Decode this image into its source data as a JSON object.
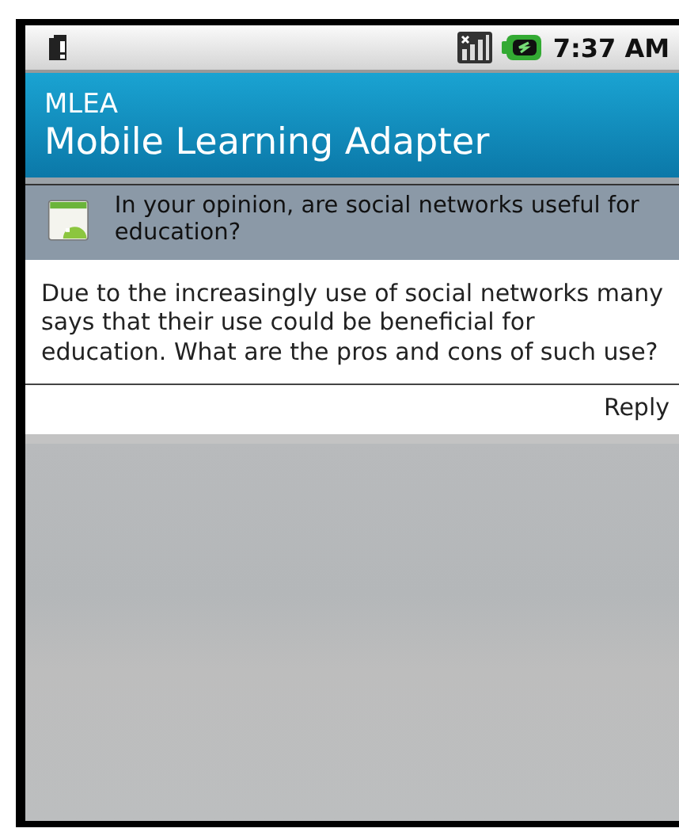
{
  "status_bar": {
    "time": "7:37 AM"
  },
  "app_bar": {
    "app_name": "MLEA",
    "title": "Mobile Learning Adapter"
  },
  "question": {
    "title": "In your opinion, are social networks useful for education?",
    "body": "Due to the increasingly use of social networks many says that their use could be beneficial for education. What are the pros and cons of such use?"
  },
  "actions": [
    "Reply"
  ]
}
